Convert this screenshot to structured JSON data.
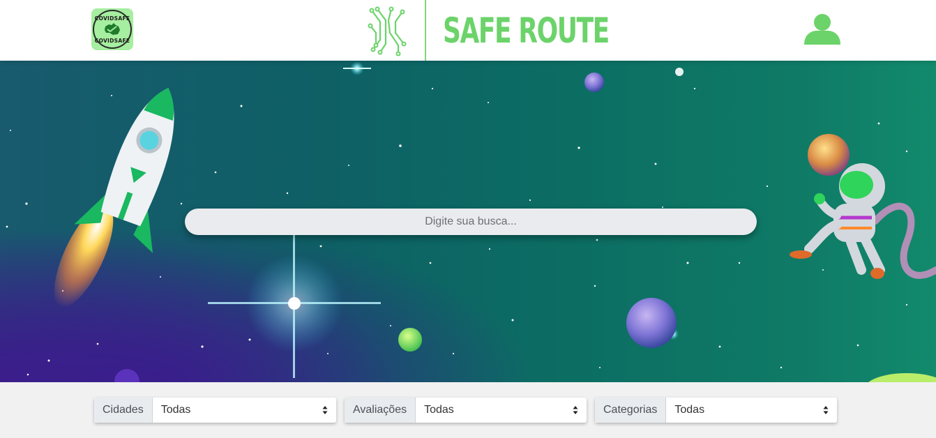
{
  "header": {
    "badge": {
      "top_text": "COVIDSAFE",
      "bottom_text": "COVIDSAFE"
    },
    "brand_title": "SAFE ROUTE",
    "brand_color": "#6cd36a"
  },
  "hero": {
    "search_placeholder": "Digite sua busca..."
  },
  "filters": [
    {
      "label": "Cidades",
      "value": "Todas"
    },
    {
      "label": "Avaliações",
      "value": "Todas"
    },
    {
      "label": "Categorias",
      "value": "Todas"
    }
  ],
  "icons": {
    "badge": "covidsafe-badge-icon",
    "brand": "circuit-logo-icon",
    "user": "user-icon",
    "rocket": "rocket-illustration",
    "astronaut": "astronaut-illustration"
  }
}
